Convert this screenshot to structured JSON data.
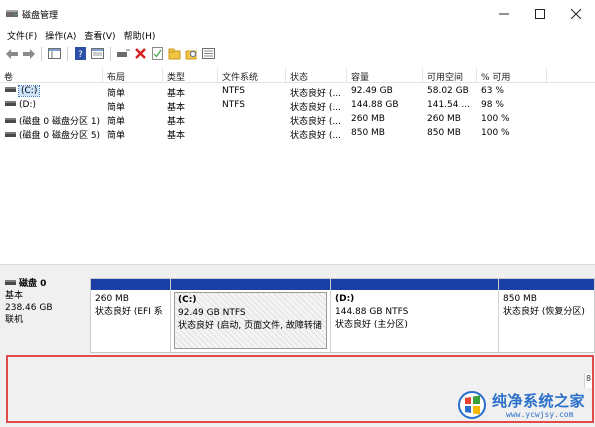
{
  "window": {
    "title": "磁盘管理"
  },
  "menu": [
    "文件(F)",
    "操作(A)",
    "查看(V)",
    "帮助(H)"
  ],
  "columns": [
    "卷",
    "布局",
    "类型",
    "文件系统",
    "状态",
    "容量",
    "可用空间",
    "% 可用"
  ],
  "volumes": [
    {
      "name": "(C:)",
      "layout": "简单",
      "type": "基本",
      "fs": "NTFS",
      "status": "状态良好 (...",
      "capacity": "92.49 GB",
      "free": "58.02 GB",
      "pct": "63 %",
      "selected": true
    },
    {
      "name": "(D:)",
      "layout": "简单",
      "type": "基本",
      "fs": "NTFS",
      "status": "状态良好 (...",
      "capacity": "144.88 GB",
      "free": "141.54 ...",
      "pct": "98 %",
      "selected": false
    },
    {
      "name": "(磁盘 0 磁盘分区 1)",
      "layout": "简单",
      "type": "基本",
      "fs": "",
      "status": "状态良好 (...",
      "capacity": "260 MB",
      "free": "260 MB",
      "pct": "100 %",
      "selected": false
    },
    {
      "name": "(磁盘 0 磁盘分区 5)",
      "layout": "简单",
      "type": "基本",
      "fs": "",
      "status": "状态良好 (...",
      "capacity": "850 MB",
      "free": "850 MB",
      "pct": "100 %",
      "selected": false
    }
  ],
  "disk0": {
    "name": "磁盘 0",
    "type": "基本",
    "size": "238.46 GB",
    "state": "联机"
  },
  "partitions": [
    {
      "name": "",
      "size": "260 MB",
      "status": "状态良好 (EFI 系"
    },
    {
      "name": "(C:)",
      "size": "92.49 GB NTFS",
      "status": "状态良好 (启动, 页面文件, 故障转储"
    },
    {
      "name": "(D:)",
      "size": "144.88 GB NTFS",
      "status": "状态良好 (主分区)"
    },
    {
      "name": "",
      "size": "850 MB",
      "status": "状态良好 (恢复分区)"
    }
  ],
  "scroll_stub": "8",
  "colors": {
    "partition_bar": "#1a3fa6",
    "highlight": "#e04a4a",
    "watermark": "#2a6fc9"
  },
  "watermark": {
    "title": "纯净系统之家",
    "url": "www.ycwjsy.com"
  }
}
